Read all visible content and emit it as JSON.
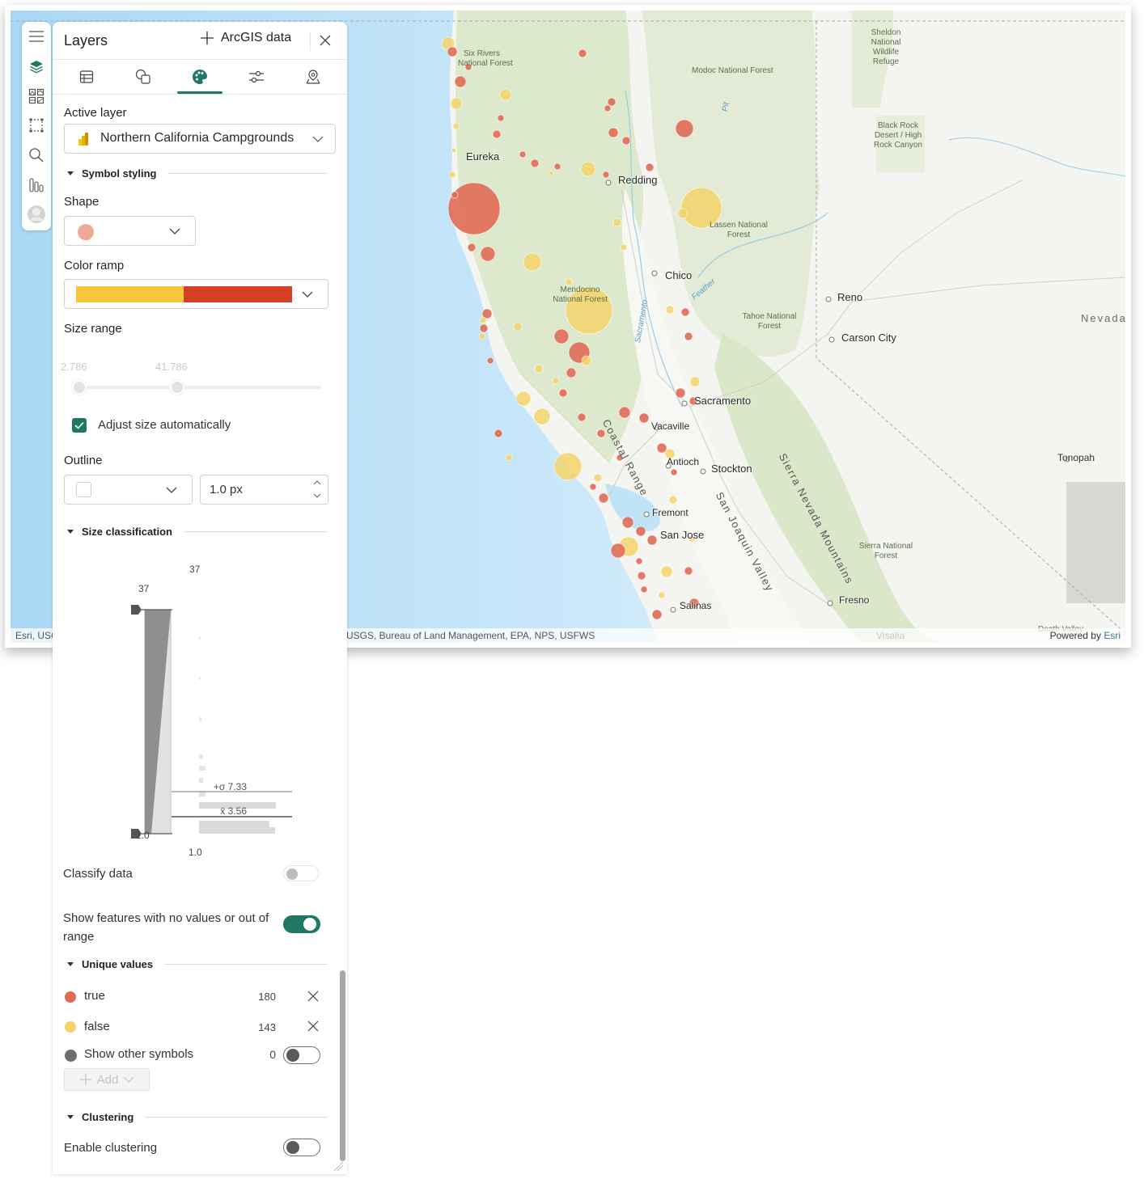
{
  "rail": {
    "items": [
      {
        "name": "menu-icon",
        "active": false
      },
      {
        "name": "layers-icon",
        "active": true
      },
      {
        "name": "basemap-gallery-icon",
        "active": false
      },
      {
        "name": "select-area-icon",
        "active": false
      },
      {
        "name": "search-icon",
        "active": false
      },
      {
        "name": "chart-bars-icon",
        "active": false
      },
      {
        "name": "user-avatar-icon",
        "active": false
      }
    ]
  },
  "panel": {
    "title": "Layers",
    "add_data_label": "ArcGIS data",
    "close_icon": "close-icon",
    "tabs": [
      {
        "name": "table-icon",
        "active": false
      },
      {
        "name": "shapes-icon",
        "active": false
      },
      {
        "name": "palette-icon",
        "active": true
      },
      {
        "name": "sliders-icon",
        "active": false
      },
      {
        "name": "map-pin-icon",
        "active": false
      }
    ],
    "active_layer": {
      "label": "Active layer",
      "value": "Northern California Campgrounds",
      "icon": "power-bi-icon"
    },
    "symbol_styling": {
      "section_title": "Symbol styling",
      "shape_label": "Shape",
      "shape_color": "#f0a898",
      "color_ramp_label": "Color ramp",
      "color_ramp": [
        "#f8c63d",
        "#d63f23"
      ],
      "size_range_label": "Size range",
      "size_min": "2.786",
      "size_max": "41.786",
      "adjust_size_label": "Adjust size automatically",
      "adjust_size_checked": true,
      "outline_label": "Outline",
      "outline_width": "1.0 px"
    },
    "size_classification": {
      "section_title": "Size classification",
      "max_top": "37",
      "max_handle": "37",
      "min_handle": "1.0",
      "min_bottom": "1.0",
      "plus_sigma": "+σ 7.33",
      "mean": "x̄ 3.56",
      "classify_label": "Classify data",
      "classify_on": false,
      "show_no_values_label": "Show features with no values or out of range",
      "show_no_values_on": true
    },
    "unique_values": {
      "section_title": "Unique values",
      "items": [
        {
          "label": "true",
          "count": "180",
          "color": "#e06c56"
        },
        {
          "label": "false",
          "count": "143",
          "color": "#f5d36a"
        }
      ],
      "other_label": "Show other symbols",
      "other_count": "0",
      "other_color": "#6e6e6e",
      "other_on": false,
      "add_label": "Add"
    },
    "clustering": {
      "section_title": "Clustering",
      "enable_label": "Enable clustering",
      "enable_on": false
    }
  },
  "map": {
    "attribution_left": "Esri, USC",
    "attribution_mid": "USGS, Bureau of Land Management, EPA, NPS, USFWS",
    "powered_by": "Powered by",
    "esri": "Esri",
    "labels": [
      {
        "text": "Six Rivers",
        "kind": "park"
      },
      {
        "text": "National Forest",
        "kind": "park"
      },
      {
        "text": "Modoc National Forest",
        "kind": "park"
      },
      {
        "text": "Sheldon National Wildlife Refuge",
        "kind": "park"
      },
      {
        "text": "Black Rock Desert / High Rock Canyon",
        "kind": "park"
      },
      {
        "text": "Eureka",
        "kind": "city"
      },
      {
        "text": "Redding",
        "kind": "city"
      },
      {
        "text": "Lassen National Forest",
        "kind": "park"
      },
      {
        "text": "Chico",
        "kind": "city"
      },
      {
        "text": "Mendocino National Forest",
        "kind": "park"
      },
      {
        "text": "Reno",
        "kind": "city"
      },
      {
        "text": "Tahoe National Forest",
        "kind": "park"
      },
      {
        "text": "Carson City",
        "kind": "city"
      },
      {
        "text": "Nevada",
        "kind": "region"
      },
      {
        "text": "Sacramento",
        "kind": "city"
      },
      {
        "text": "Vacaville",
        "kind": "city"
      },
      {
        "text": "Sierra Nevada Mountains",
        "kind": "range"
      },
      {
        "text": "Coastal Range",
        "kind": "range"
      },
      {
        "text": "Antioch",
        "kind": "city"
      },
      {
        "text": "Stockton",
        "kind": "city"
      },
      {
        "text": "Tonopah",
        "kind": "city"
      },
      {
        "text": "Fremont",
        "kind": "city"
      },
      {
        "text": "San Joaquin Valley",
        "kind": "range"
      },
      {
        "text": "San Jose",
        "kind": "city"
      },
      {
        "text": "Sierra National Forest",
        "kind": "park"
      },
      {
        "text": "Fresno",
        "kind": "city"
      },
      {
        "text": "Salinas",
        "kind": "city"
      },
      {
        "text": "Death Valley",
        "kind": "park"
      },
      {
        "text": "Visalia",
        "kind": "city"
      },
      {
        "text": "Sacramento",
        "kind": "river"
      },
      {
        "text": "Feather",
        "kind": "river"
      },
      {
        "text": "Pit",
        "kind": "river"
      }
    ]
  }
}
